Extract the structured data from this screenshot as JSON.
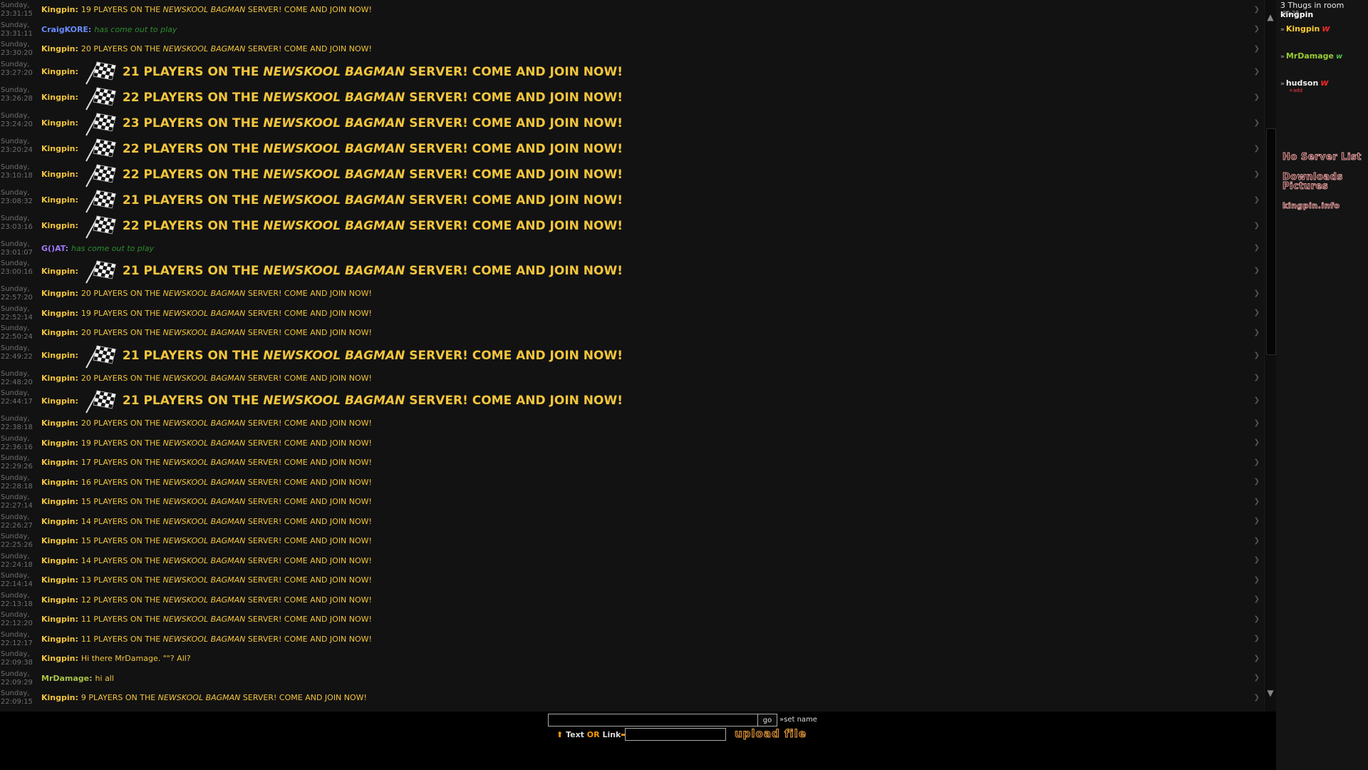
{
  "room": {
    "count_text": "3 Thugs in room",
    "name": "kingpin",
    "clock": "00:28"
  },
  "users": [
    {
      "name": "Kingpin",
      "badge": "W",
      "color": "#ffcc33",
      "badge_color": "#ff2a2a",
      "sub": ""
    },
    {
      "name": "MrDamage",
      "badge": "w",
      "color": "#99cc33",
      "badge_color": "#4fbf4f",
      "sub": ""
    },
    {
      "name": "hudson",
      "badge": "W",
      "color": "#f0f0f0",
      "badge_color": "#ff2a2a",
      "sub": "+add"
    }
  ],
  "links": {
    "server_list": "Ho Server List",
    "downloads": "Downloads",
    "pictures": "Pictures",
    "info": "kingpin.info"
  },
  "composer": {
    "go_label": "go",
    "set_name_label": "»set name",
    "text_label": "Text",
    "or_label": "OR",
    "link_label": "Link",
    "upload_label": "upload file",
    "text_arrow": "⬆",
    "link_arrow": "➡"
  },
  "server_text": {
    "pre": "PLAYERS ON THE",
    "server": "NEWSKOOL BAGMAN",
    "post": "SERVER! COME AND JOIN NOW!"
  },
  "messages": [
    {
      "day": "Sunday,",
      "time": "23:31:15",
      "nick": "Kingpin:",
      "nick_color": "#f2c53d",
      "kind": "small",
      "count": "19"
    },
    {
      "day": "Sunday,",
      "time": "23:31:11",
      "nick": "CraigKORE:",
      "nick_color": "#6a8cff",
      "kind": "join",
      "text": "has come out to play"
    },
    {
      "day": "Sunday,",
      "time": "23:30:20",
      "nick": "Kingpin:",
      "nick_color": "#f2c53d",
      "kind": "small",
      "count": "20"
    },
    {
      "day": "Sunday,",
      "time": "23:27:20",
      "nick": "Kingpin:",
      "nick_color": "#f2c53d",
      "kind": "big",
      "count": "21"
    },
    {
      "day": "Sunday,",
      "time": "23:26:28",
      "nick": "Kingpin:",
      "nick_color": "#f2c53d",
      "kind": "big",
      "count": "22"
    },
    {
      "day": "Sunday,",
      "time": "23:24:20",
      "nick": "Kingpin:",
      "nick_color": "#f2c53d",
      "kind": "big",
      "count": "23"
    },
    {
      "day": "Sunday,",
      "time": "23:20:24",
      "nick": "Kingpin:",
      "nick_color": "#f2c53d",
      "kind": "big",
      "count": "22"
    },
    {
      "day": "Sunday,",
      "time": "23:10:18",
      "nick": "Kingpin:",
      "nick_color": "#f2c53d",
      "kind": "big",
      "count": "22"
    },
    {
      "day": "Sunday,",
      "time": "23:08:32",
      "nick": "Kingpin:",
      "nick_color": "#f2c53d",
      "kind": "big",
      "count": "21"
    },
    {
      "day": "Sunday,",
      "time": "23:03:16",
      "nick": "Kingpin:",
      "nick_color": "#f2c53d",
      "kind": "big",
      "count": "22"
    },
    {
      "day": "Sunday,",
      "time": "23:01:07",
      "nick": "G()AT:",
      "nick_color": "#a07bff",
      "kind": "join",
      "text": "has come out to play"
    },
    {
      "day": "Sunday,",
      "time": "23:00:16",
      "nick": "Kingpin:",
      "nick_color": "#f2c53d",
      "kind": "big",
      "count": "21"
    },
    {
      "day": "Sunday,",
      "time": "22:57:20",
      "nick": "Kingpin:",
      "nick_color": "#f2c53d",
      "kind": "small",
      "count": "20"
    },
    {
      "day": "Sunday,",
      "time": "22:52:14",
      "nick": "Kingpin:",
      "nick_color": "#f2c53d",
      "kind": "small",
      "count": "19"
    },
    {
      "day": "Sunday,",
      "time": "22:50:24",
      "nick": "Kingpin:",
      "nick_color": "#f2c53d",
      "kind": "small",
      "count": "20"
    },
    {
      "day": "Sunday,",
      "time": "22:49:22",
      "nick": "Kingpin:",
      "nick_color": "#f2c53d",
      "kind": "big",
      "count": "21"
    },
    {
      "day": "Sunday,",
      "time": "22:48:20",
      "nick": "Kingpin:",
      "nick_color": "#f2c53d",
      "kind": "small",
      "count": "20"
    },
    {
      "day": "Sunday,",
      "time": "22:44:17",
      "nick": "Kingpin:",
      "nick_color": "#f2c53d",
      "kind": "big",
      "count": "21"
    },
    {
      "day": "Sunday,",
      "time": "22:38:18",
      "nick": "Kingpin:",
      "nick_color": "#f2c53d",
      "kind": "small",
      "count": "20"
    },
    {
      "day": "Sunday,",
      "time": "22:36:16",
      "nick": "Kingpin:",
      "nick_color": "#f2c53d",
      "kind": "small",
      "count": "19"
    },
    {
      "day": "Sunday,",
      "time": "22:29:26",
      "nick": "Kingpin:",
      "nick_color": "#f2c53d",
      "kind": "small",
      "count": "17"
    },
    {
      "day": "Sunday,",
      "time": "22:28:18",
      "nick": "Kingpin:",
      "nick_color": "#f2c53d",
      "kind": "small",
      "count": "16"
    },
    {
      "day": "Sunday,",
      "time": "22:27:14",
      "nick": "Kingpin:",
      "nick_color": "#f2c53d",
      "kind": "small",
      "count": "15"
    },
    {
      "day": "Sunday,",
      "time": "22:26:27",
      "nick": "Kingpin:",
      "nick_color": "#f2c53d",
      "kind": "small",
      "count": "14"
    },
    {
      "day": "Sunday,",
      "time": "22:25:26",
      "nick": "Kingpin:",
      "nick_color": "#f2c53d",
      "kind": "small",
      "count": "15"
    },
    {
      "day": "Sunday,",
      "time": "22:24:18",
      "nick": "Kingpin:",
      "nick_color": "#f2c53d",
      "kind": "small",
      "count": "14"
    },
    {
      "day": "Sunday,",
      "time": "22:14:14",
      "nick": "Kingpin:",
      "nick_color": "#f2c53d",
      "kind": "small",
      "count": "13"
    },
    {
      "day": "Sunday,",
      "time": "22:13:18",
      "nick": "Kingpin:",
      "nick_color": "#f2c53d",
      "kind": "small",
      "count": "12"
    },
    {
      "day": "Sunday,",
      "time": "22:12:20",
      "nick": "Kingpin:",
      "nick_color": "#f2c53d",
      "kind": "small",
      "count": "11"
    },
    {
      "day": "Sunday,",
      "time": "22:12:17",
      "nick": "Kingpin:",
      "nick_color": "#f2c53d",
      "kind": "small",
      "count": "11"
    },
    {
      "day": "Sunday,",
      "time": "22:09:38",
      "nick": "Kingpin:",
      "nick_color": "#f2c53d",
      "kind": "plain",
      "text": "Hi there MrDamage. \"\"? All?"
    },
    {
      "day": "Sunday,",
      "time": "22:09:29",
      "nick": "MrDamage:",
      "nick_color": "#a8c24a",
      "kind": "plain",
      "text": "hi all"
    },
    {
      "day": "Sunday,",
      "time": "22:09:15",
      "nick": "Kingpin:",
      "nick_color": "#f2c53d",
      "kind": "small",
      "count": "9"
    }
  ]
}
